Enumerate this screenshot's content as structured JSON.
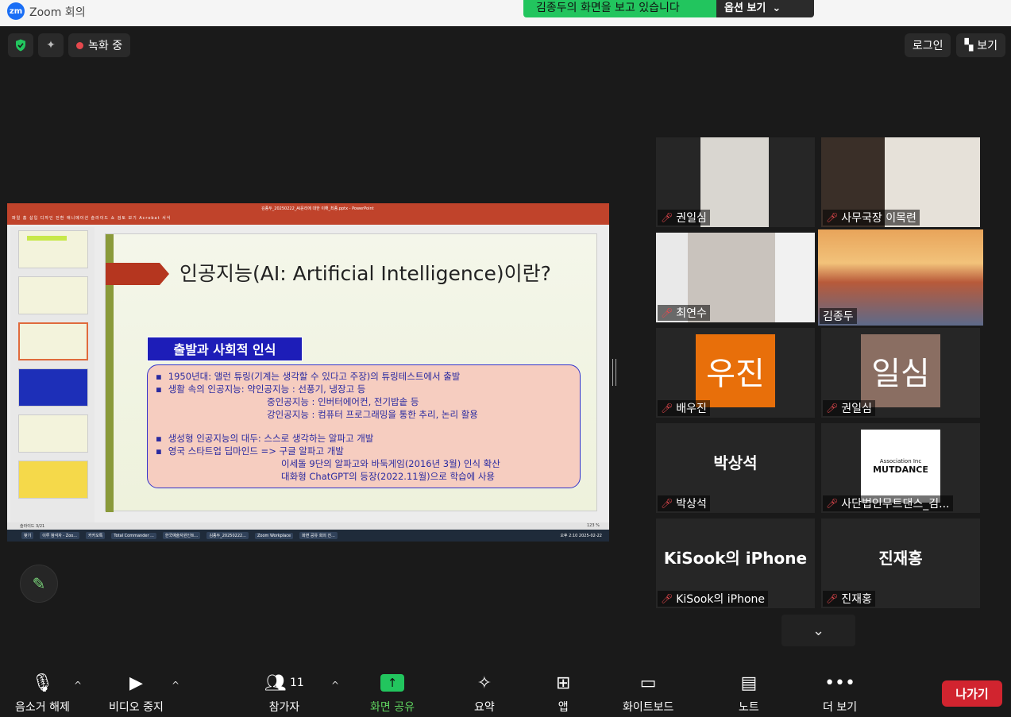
{
  "window": {
    "app_logo": "zm",
    "title": "Zoom 회의"
  },
  "share_banner": {
    "message": "김종두의 화면을 보고 있습니다",
    "options_label": "옵션 보기"
  },
  "top_left": {
    "recording_label": "녹화 중"
  },
  "top_right": {
    "login_label": "로그인",
    "view_label": "보기"
  },
  "shared_screen": {
    "ppt_title": "김종두_20250222_AI윤리에 대한 이해_최종.pptx - PowerPoint",
    "ppt_menu": "파일  홈  삽입  디자인  전환  애니메이션  슬라이드 쇼  검토  보기  Acrobat  서식",
    "slide_title": "인공지능(AI: Artificial Intelligence)이란?",
    "section_title": "출발과 사회적 인식",
    "lines": [
      "1950년대: 앨런 튜링(기계는 생각할 수 있다고 주장)의 튜링테스트에서 출발",
      "생활 속의 인공지능: 약인공지능 : 선풍기, 냉장고 등",
      "중인공지능 : 인버터에어컨, 전기밥솥 등",
      "강인공지능 : 컴퓨터 프로그래밍을 통한 추리, 논리 활용",
      "생성형 인공지능의 대두: 스스로 생각하는 알파고 개발",
      "영국 스타트업 딥마인드 => 구글 알파고 개발",
      "이세돌 9단의 알파고와 바둑게임(2016년 3월) 인식 확산",
      "대화형 ChatGPT의 등장(2022.11월)으로 학습에 사용"
    ],
    "status_left": "슬라이드 3/21",
    "status_right": "123 %",
    "taskbar_items": [
      "찾기",
      "이루 참석자 - Zoo...",
      "카카오톡",
      "Total Commander ...",
      "한국예술자원인트...",
      "김종두_20250222...",
      "Zoom Workplace",
      "화면 공유 회의 진..."
    ],
    "clock": "오후 2:10 2025-02-22"
  },
  "participants": [
    {
      "name": "권일심",
      "muted": true,
      "kind": "video"
    },
    {
      "name": "사무국장 이목련",
      "muted": true,
      "kind": "video"
    },
    {
      "name": "최연수",
      "muted": true,
      "kind": "video"
    },
    {
      "name": "김종두",
      "muted": false,
      "kind": "video",
      "active": true
    },
    {
      "name": "배우진",
      "muted": true,
      "kind": "avatar",
      "avatar_text": "우진",
      "avatar_color": "#e86f0a"
    },
    {
      "name": "권일심",
      "muted": true,
      "kind": "avatar",
      "avatar_text": "일심",
      "avatar_color": "#8a6e62"
    },
    {
      "name": "박상석",
      "muted": true,
      "kind": "text",
      "display": "박상석"
    },
    {
      "name": "사단법인무트댄스_김...",
      "muted": true,
      "kind": "logo",
      "logo_text": "MUTDANCE",
      "logo_sub": "Association Inc"
    },
    {
      "name": "KiSook의 iPhone",
      "muted": true,
      "kind": "text",
      "display": "KiSook의 iPhone"
    },
    {
      "name": "진재홍",
      "muted": true,
      "kind": "text",
      "display": "진재홍"
    }
  ],
  "toolbar": {
    "unmute": "음소거 해제",
    "video": "비디오 중지",
    "participants": "참가자",
    "participants_count": "11",
    "share": "화면 공유",
    "summary": "요약",
    "apps": "앱",
    "whiteboard": "화이트보드",
    "notes": "노트",
    "more": "더 보기",
    "leave": "나가기"
  },
  "colors": {
    "share_green": "#22c55e",
    "leave_red": "#d1242f",
    "active_speaker": "#d8e05a"
  }
}
